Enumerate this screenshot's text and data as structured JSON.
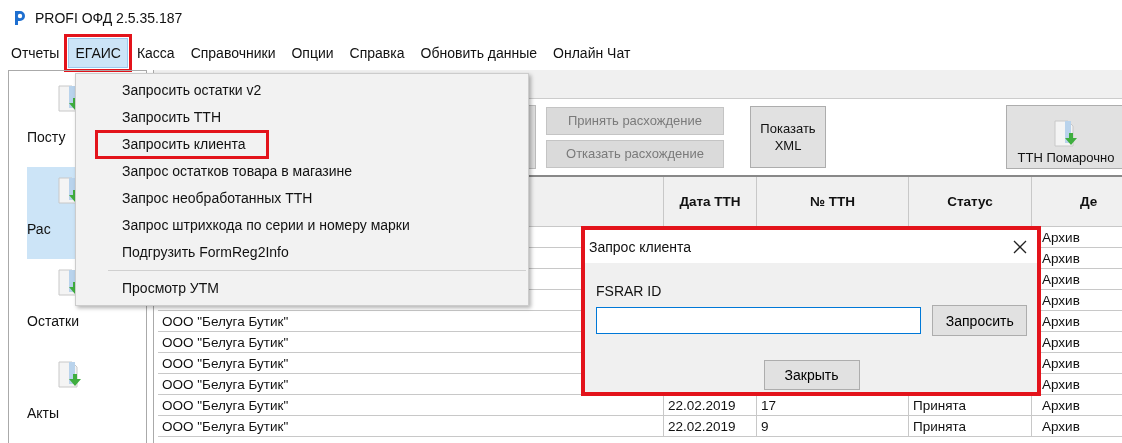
{
  "window": {
    "title": "PROFI ОФД 2.5.35.187"
  },
  "menubar": [
    {
      "label": "Отчеты",
      "open": false,
      "highlighted": false
    },
    {
      "label": "ЕГАИС",
      "open": true,
      "highlighted": true
    },
    {
      "label": "Касса",
      "open": false,
      "highlighted": false
    },
    {
      "label": "Справочники",
      "open": false,
      "highlighted": false
    },
    {
      "label": "Опции",
      "open": false,
      "highlighted": false
    },
    {
      "label": "Справка",
      "open": false,
      "highlighted": false
    },
    {
      "label": "Обновить данные",
      "open": false,
      "highlighted": false
    },
    {
      "label": "Онлайн Чат",
      "open": false,
      "highlighted": false
    }
  ],
  "dropdown": [
    {
      "kind": "item",
      "label": "Запросить остатки v2",
      "highlighted": false
    },
    {
      "kind": "item",
      "label": "Запросить ТТН",
      "highlighted": false
    },
    {
      "kind": "item",
      "label": "Запросить клиента",
      "highlighted": true
    },
    {
      "kind": "item",
      "label": "Запрос остатков товара в магазине",
      "highlighted": false
    },
    {
      "kind": "item",
      "label": "Запрос необработанных ТТН",
      "highlighted": false
    },
    {
      "kind": "item",
      "label": "Запрос штрихкода по серии и номеру марки",
      "highlighted": false
    },
    {
      "kind": "item",
      "label": "Подгрузить FormReg2Info",
      "highlighted": false
    },
    {
      "kind": "separator"
    },
    {
      "kind": "item",
      "label": "Просмотр УТМ",
      "highlighted": false
    }
  ],
  "sidebar": {
    "items": [
      {
        "label": "Посту",
        "selected": false
      },
      {
        "label": "Рас",
        "selected": true
      },
      {
        "label": "Остатки",
        "selected": false
      },
      {
        "label": "Акты",
        "selected": false
      }
    ]
  },
  "toolbar": {
    "buttons": [
      {
        "label": "Принять расхождение",
        "disabled": true
      },
      {
        "label": "Отказать расхождение",
        "disabled": true
      },
      {
        "label": "Показать XML",
        "disabled": false
      },
      {
        "label": "ТТН Помарочно",
        "disabled": false
      }
    ]
  },
  "table": {
    "columns": [
      "",
      "Дата ТТН",
      "№ ТТН",
      "Статус",
      "Де"
    ],
    "rows": [
      {
        "column_5": "Архив"
      },
      {
        "column_5": "Архив"
      },
      {
        "column_5": "Архив"
      },
      {
        "column_5": "Архив"
      },
      {
        "name": "ООО \"Белуга Бутик\"",
        "column_5": "Архив"
      },
      {
        "name": "ООО \"Белуга Бутик\"",
        "column_5": "Архив"
      },
      {
        "name": "ООО \"Белуга Бутик\"",
        "column_5": "Архив"
      },
      {
        "name": "ООО \"Белуга Бутик\"",
        "column_5": "Архив"
      },
      {
        "name": "ООО \"Белуга Бутик\"",
        "date": "22.02.2019",
        "number": "17",
        "status": "Принята",
        "column_5": "Архив"
      },
      {
        "name": "ООО \"Белуга Бутик\"",
        "date": "22.02.2019",
        "number": "9",
        "status": "Принята",
        "column_5": "Архив"
      }
    ]
  },
  "dialog": {
    "title": "Запрос клиента",
    "highlighted": true,
    "field_label": "FSRAR ID",
    "request_button": "Запросить",
    "close_button": "Закрыть"
  }
}
